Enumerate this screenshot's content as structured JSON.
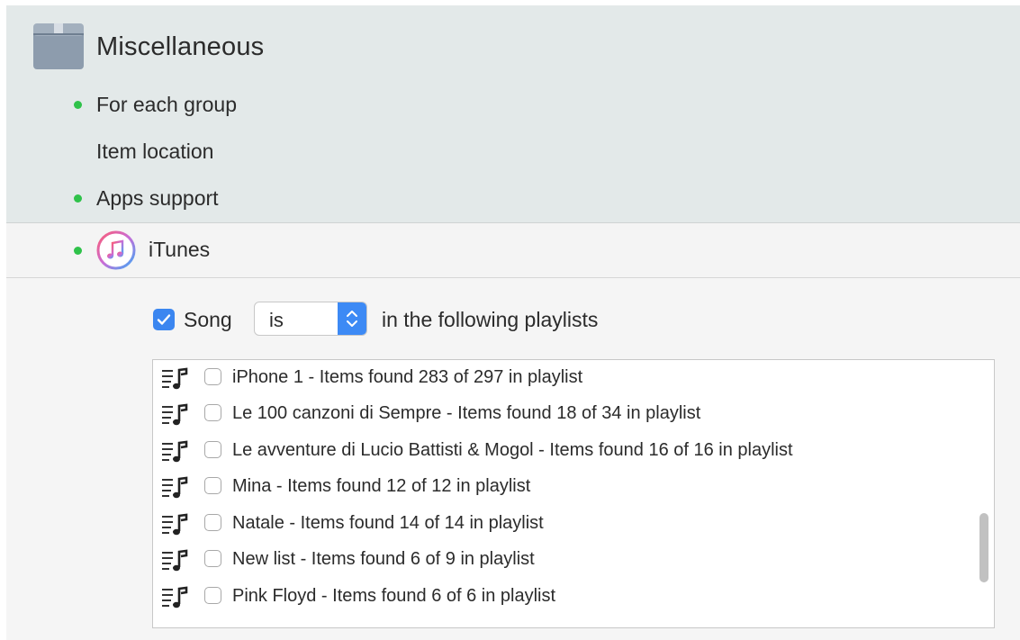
{
  "category": {
    "title": "Miscellaneous",
    "icon": "box-icon",
    "items": [
      {
        "label": "For each group",
        "active": true
      },
      {
        "label": "Item location",
        "active": false
      },
      {
        "label": "Apps support",
        "active": true
      }
    ]
  },
  "itunes": {
    "label": "iTunes",
    "icon": "itunes-icon",
    "active": true
  },
  "condition": {
    "checked": true,
    "field_label": "Song",
    "operator_value": "is",
    "suffix_text": "in the following playlists"
  },
  "playlists": [
    {
      "label": "iPhone 1 - Items found 283 of 297 in playlist",
      "checked": false
    },
    {
      "label": "Le 100 canzoni di Sempre - Items found 18 of 34 in playlist",
      "checked": false
    },
    {
      "label": "Le avventure di Lucio Battisti & Mogol - Items found 16 of 16 in playlist",
      "checked": false
    },
    {
      "label": "Mina - Items found 12 of 12 in playlist",
      "checked": false
    },
    {
      "label": "Natale - Items found 14 of 14 in playlist",
      "checked": false
    },
    {
      "label": "New list - Items found 6 of 9 in playlist",
      "checked": false
    },
    {
      "label": "Pink Floyd - Items found 6 of 6 in playlist",
      "checked": false
    }
  ],
  "colors": {
    "active_dot": "#2fc24a",
    "accent": "#3b86f0",
    "header_bg": "#e3e9e9"
  }
}
